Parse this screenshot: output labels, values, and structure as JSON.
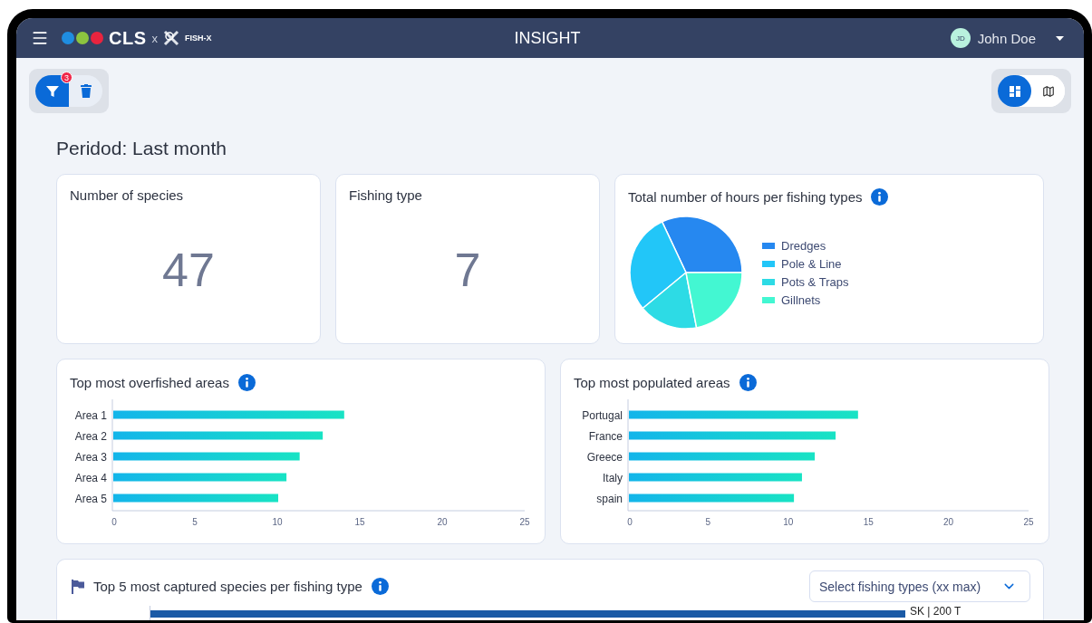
{
  "header": {
    "brand": "CLS",
    "separator": "x",
    "partner": "FISH-X",
    "title": "INSIGHT",
    "user": {
      "initials": "JD",
      "name": "John Doe"
    }
  },
  "actions": [
    {
      "kind": "filter",
      "badge": "3",
      "active": true
    },
    {
      "kind": "delete",
      "active": false
    }
  ],
  "views": [
    {
      "kind": "dashboard",
      "selected": true
    },
    {
      "kind": "map",
      "selected": false
    }
  ],
  "period": "Peridod: Last month",
  "stats": [
    {
      "label": "Number of species",
      "value": "47"
    },
    {
      "label": "Fishing type",
      "value": "7"
    }
  ],
  "hours_card": {
    "title": "Total number of hours per fishing types",
    "chart_data": {
      "type": "pie",
      "categories": [
        "Dredges",
        "Pole & Line",
        "Pots & Traps",
        "Gillnets"
      ],
      "values": [
        32,
        29,
        17,
        22
      ],
      "colors": [
        "#2688f0",
        "#22c6f8",
        "#2ddbe5",
        "#43f7d2"
      ]
    }
  },
  "bar_cards": [
    {
      "title": "Top most overfished areas",
      "chart_data": {
        "type": "bar",
        "orientation": "horizontal",
        "categories": [
          "Area 1",
          "Area 2",
          "Area 3",
          "Area 4",
          "Area 5"
        ],
        "values": [
          14,
          12.7,
          11.3,
          10.5,
          10
        ],
        "xlim": [
          0,
          25
        ],
        "xticks": [
          0,
          5,
          10,
          15,
          20,
          25
        ]
      }
    },
    {
      "title": "Top most populated areas",
      "chart_data": {
        "type": "bar",
        "orientation": "horizontal",
        "categories": [
          "Portugal",
          "France",
          "Greece",
          "Italy",
          "spain"
        ],
        "values": [
          14.3,
          12.9,
          11.6,
          10.8,
          10.3
        ],
        "xlim": [
          0,
          25
        ],
        "xticks": [
          0,
          5,
          10,
          15,
          20,
          25
        ]
      }
    }
  ],
  "species_card": {
    "title": "Top 5 most captured species per fishing type",
    "select": {
      "placeholder": "Select fishing types (xx max)"
    },
    "bar_label": "SK | 200 T"
  }
}
